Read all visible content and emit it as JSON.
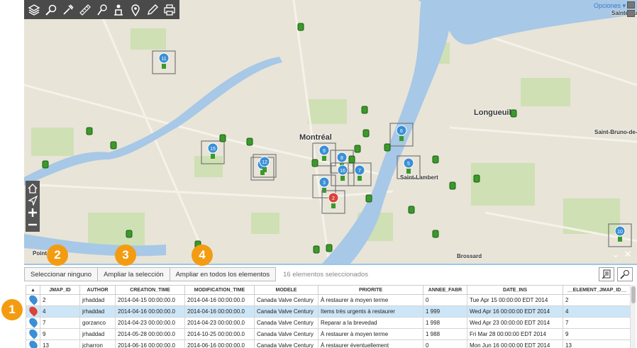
{
  "map": {
    "labels": {
      "montreal": "Montréal",
      "longueuil": "Longueuil",
      "saint_bruno": "Saint-Bruno-de-M",
      "saint_lambert": "Saint-Lambert",
      "brossard": "Brossard",
      "pointe": "Pointe",
      "sainte_julie": "Sainte-Jul"
    },
    "opciones": "Opciones ▾",
    "markers": [
      "11",
      "15",
      "4",
      "12",
      "9",
      "8",
      "6",
      "16",
      "3",
      "7",
      "5",
      "2",
      "10"
    ]
  },
  "callouts": [
    "1",
    "2",
    "3",
    "4"
  ],
  "panel": {
    "select_none": "Seleccionar ninguno",
    "zoom_selection": "Ampliar la selección",
    "zoom_all": "Ampliar en todos los elementos",
    "selected_count": "16 elementos seleccionados"
  },
  "table": {
    "columns": [
      "JMAP_ID",
      "AUTHOR",
      "CREATION_TIME",
      "MODIFICATION_TIME",
      "MODELE",
      "PRIORITE",
      "ANNEE_FABR",
      "DATE_INS",
      "__ELEMENT_JMAP_ID__"
    ],
    "rows": [
      {
        "marker": "1",
        "jmap_id": "2",
        "author": "jrhaddad",
        "creation": "2014-04-15 00:00:00.0",
        "modification": "2014-04-16 00:00:00.0",
        "modele": "Canada Valve Century",
        "priorite": "À restaurer à moyen terme",
        "annee": "0",
        "date_ins": "Tue Apr 15 00:00:00 EDT 2014",
        "element_id": "2"
      },
      {
        "marker": "2",
        "jmap_id": "4",
        "author": "jrhaddad",
        "creation": "2014-04-16 00:00:00.0",
        "modification": "2014-04-16 00:00:00.0",
        "modele": "Canada Valve Century",
        "priorite": "Items très urgents à restaurer",
        "annee": "1 999",
        "date_ins": "Wed Apr 16 00:00:00 EDT 2014",
        "element_id": "4"
      },
      {
        "marker": "3",
        "jmap_id": "7",
        "author": "gorzanco",
        "creation": "2014-04-23 00:00:00.0",
        "modification": "2014-04-23 00:00:00.0",
        "modele": "Canada Valve Century",
        "priorite": "Reparar a la brevedad",
        "annee": "1 998",
        "date_ins": "Wed Apr 23 00:00:00 EDT 2014",
        "element_id": "7"
      },
      {
        "marker": "4",
        "jmap_id": "9",
        "author": "jrhaddad",
        "creation": "2014-05-28 00:00:00.0",
        "modification": "2014-10-25 00:00:00.0",
        "modele": "Canada Valve Century",
        "priorite": "À restaurer à moyen terme",
        "annee": "1 988",
        "date_ins": "Fri Mar 28 00:00:00 EDT 2014",
        "element_id": "9"
      },
      {
        "marker": "5",
        "jmap_id": "13",
        "author": "jcharron",
        "creation": "2014-06-16 00:00:00.0",
        "modification": "2014-06-16 00:00:00.0",
        "modele": "Canada Valve Century",
        "priorite": "À restaurer éventuellement",
        "annee": "0",
        "date_ins": "Mon Jun 16 00:00:00 EDT 2014",
        "element_id": "13"
      }
    ]
  },
  "colors": {
    "accent": "#f39c12",
    "pin_blue": "#3a8fd6",
    "pin_red": "#d9443a",
    "selected_row": "#cde6f7",
    "water": "#a7c8e6",
    "park": "#cfe0b4"
  },
  "icons": [
    "layers-icon",
    "search-icon",
    "tools-icon",
    "measure-icon",
    "pin-search-icon",
    "person-icon",
    "location-icon",
    "edit-icon",
    "print-icon",
    "home-icon",
    "navigate-icon",
    "zoom-in-icon",
    "zoom-out-icon",
    "export-icon",
    "map-search-icon"
  ]
}
